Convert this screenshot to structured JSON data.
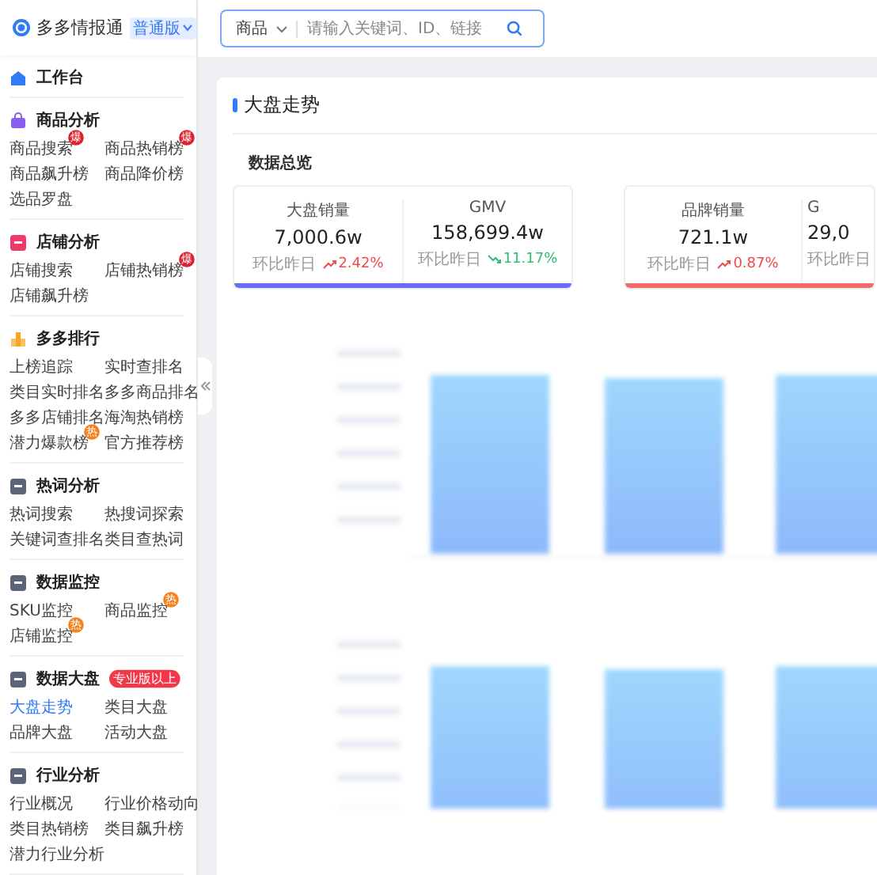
{
  "app": {
    "name": "多多情报通",
    "edition": "普通版"
  },
  "search": {
    "category": "商品",
    "placeholder": "请输入关键词、ID、链接"
  },
  "sidebar": {
    "sections": [
      {
        "title": "工作台"
      },
      {
        "title": "商品分析",
        "items": [
          {
            "label": "商品搜索",
            "selected": false,
            "badge": {
              "text": "爆",
              "color": "#e0202e"
            }
          },
          {
            "label": "商品热销榜",
            "selected": false,
            "badge": {
              "text": "爆",
              "color": "#e0202e"
            }
          },
          {
            "label": "商品飙升榜",
            "selected": false
          },
          {
            "label": "商品降价榜",
            "selected": false
          },
          {
            "label": "选品罗盘",
            "selected": false
          }
        ]
      },
      {
        "title": "店铺分析",
        "items": [
          {
            "label": "店铺搜索",
            "selected": false
          },
          {
            "label": "店铺热销榜",
            "selected": false,
            "badge": {
              "text": "爆",
              "color": "#e0202e"
            }
          },
          {
            "label": "店铺飙升榜",
            "selected": false
          }
        ]
      },
      {
        "title": "多多排行",
        "items": [
          {
            "label": "上榜追踪",
            "selected": false
          },
          {
            "label": "实时查排名",
            "selected": false
          },
          {
            "label": "类目实时排名",
            "selected": false
          },
          {
            "label": "多多商品排名",
            "selected": false
          },
          {
            "label": "多多店铺排名",
            "selected": false
          },
          {
            "label": "海淘热销榜",
            "selected": false
          },
          {
            "label": "潜力爆款榜",
            "selected": false,
            "badge": {
              "text": "热",
              "color": "#f5821f"
            }
          },
          {
            "label": "官方推荐榜",
            "selected": false
          }
        ]
      },
      {
        "title": "热词分析",
        "items": [
          {
            "label": "热词搜索",
            "selected": false
          },
          {
            "label": "热搜词探索",
            "selected": false
          },
          {
            "label": "关键词查排名",
            "selected": false
          },
          {
            "label": "类目查热词",
            "selected": false
          }
        ]
      },
      {
        "title": "数据监控",
        "items": [
          {
            "label": "SKU监控",
            "selected": false
          },
          {
            "label": "商品监控",
            "selected": false,
            "badge": {
              "text": "热",
              "color": "#f5821f"
            }
          },
          {
            "label": "店铺监控",
            "selected": false,
            "badge": {
              "text": "热",
              "color": "#f5821f"
            }
          }
        ]
      },
      {
        "title": "数据大盘",
        "tag": "专业版以上",
        "items": [
          {
            "label": "大盘走势",
            "selected": true
          },
          {
            "label": "类目大盘",
            "selected": false
          },
          {
            "label": "品牌大盘",
            "selected": false
          },
          {
            "label": "活动大盘",
            "selected": false
          }
        ]
      },
      {
        "title": "行业分析",
        "items": [
          {
            "label": "行业概况",
            "selected": false
          },
          {
            "label": "行业价格动向",
            "selected": false
          },
          {
            "label": "类目热销榜",
            "selected": false
          },
          {
            "label": "类目飙升榜",
            "selected": false
          },
          {
            "label": "潜力行业分析",
            "selected": false
          }
        ]
      }
    ]
  },
  "page": {
    "title": "大盘走势",
    "overview_title": "数据总览",
    "groups": [
      {
        "color": "#6b6cf6",
        "metrics": [
          {
            "label": "大盘销量",
            "value": "7,000.6w",
            "change_label": "环比昨日",
            "change": "2.42%",
            "rising": true
          },
          {
            "label": "GMV",
            "value": "158,699.4w",
            "change_label": "环比昨日",
            "change": "11.17%",
            "rising": false
          }
        ]
      },
      {
        "color": "#f36a6a",
        "metrics": [
          {
            "label": "品牌销量",
            "value": "721.1w",
            "change_label": "环比昨日",
            "change": "0.87%",
            "rising": true
          },
          {
            "label": "G",
            "value": "29,0",
            "change_label": "环比昨日"
          }
        ]
      }
    ]
  }
}
